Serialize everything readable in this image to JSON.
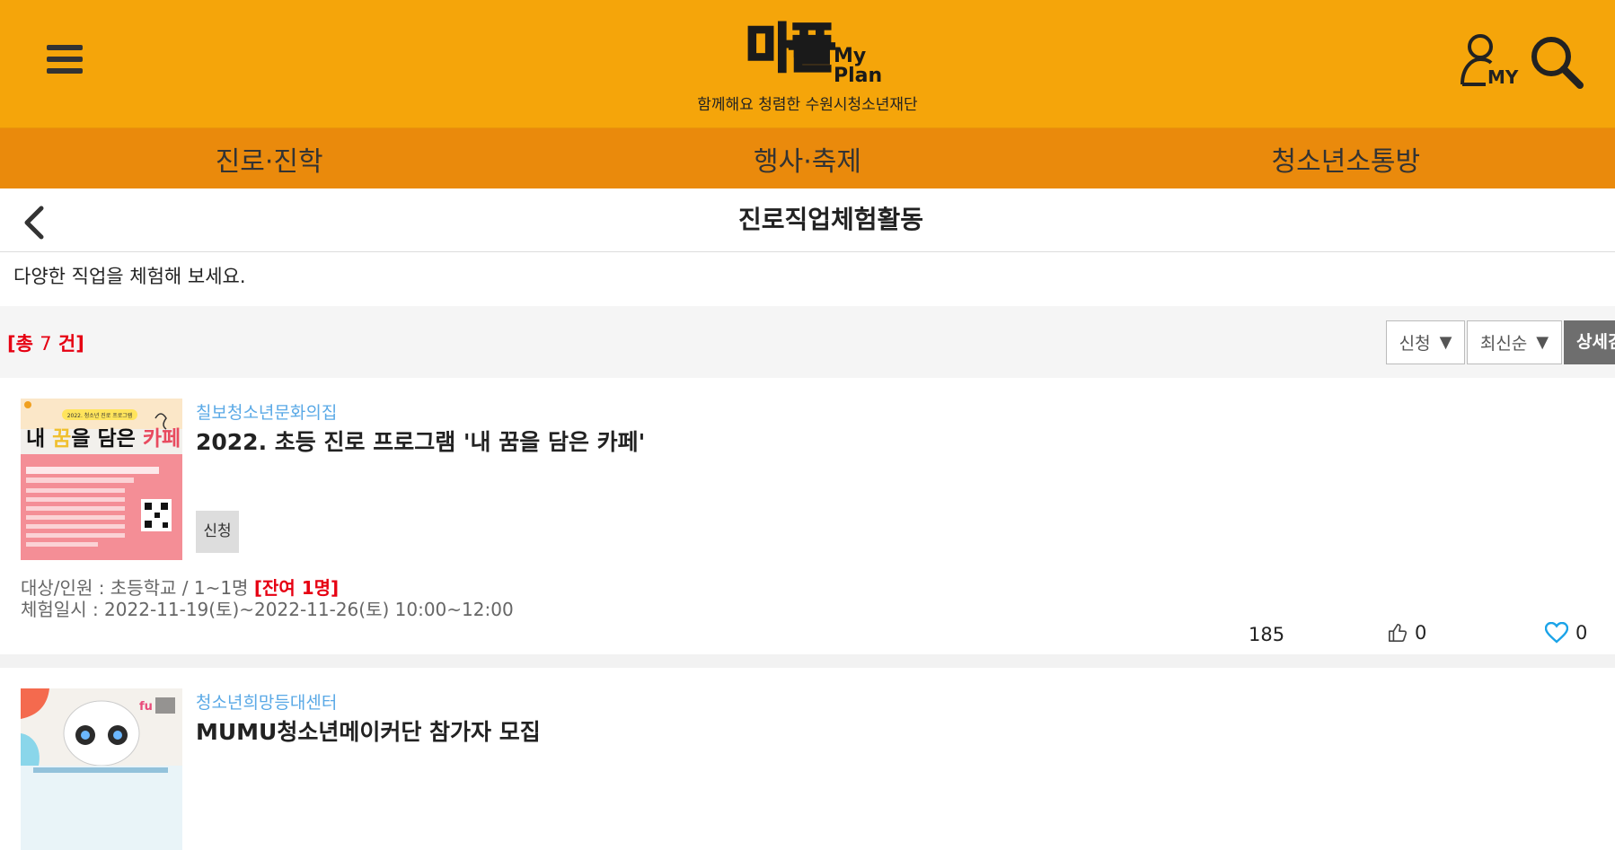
{
  "header": {
    "logo_text": "마플",
    "logo_sub_1": "My",
    "logo_sub_2": "Plan",
    "slogan": "함께해요 청렴한 수원시청소년재단",
    "my_label": "MY"
  },
  "nav": {
    "items": [
      {
        "label": "진로·진학"
      },
      {
        "label": "행사·축제"
      },
      {
        "label": "청소년소통방"
      }
    ]
  },
  "page": {
    "title": "진로직업체험활동",
    "intro": "다양한 직업을 체험해 보세요."
  },
  "filter": {
    "count_prefix": "[총",
    "count": "7",
    "count_suffix": "건]",
    "status_select": "신청",
    "sort_select": "최신순",
    "detail_button": "상세검"
  },
  "cards": [
    {
      "org": "칠보청소년문화의집",
      "title": "2022. 초등 진로 프로그램 '내 꿈을 담은 카페'",
      "status": "신청",
      "target_label": "대상/인원 : 초등학교 /  1~1명",
      "remain": "[잔여 1명]",
      "date_label": "체험일시 : 2022-11-19(토)~2022-11-26(토)  10:00~12:00",
      "views": "185",
      "likes": "0",
      "favorites": "0",
      "poster": {
        "top_line": "2022. 청소년 진로 프로그램",
        "headline_1": "내 ",
        "headline_2": "꿈",
        "headline_3": "을 담은 ",
        "headline_4": "카페"
      }
    },
    {
      "org": "청소년희망등대센터",
      "title": "MUMU청소년메이커단 참가자 모집"
    }
  ]
}
